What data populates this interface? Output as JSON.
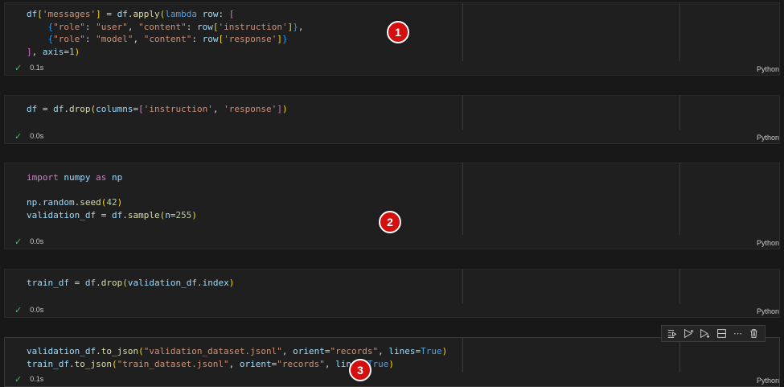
{
  "cells": [
    {
      "status_time": "0.1s",
      "language": "Python",
      "lines": [
        [
          [
            "v",
            "df"
          ],
          [
            "p",
            "["
          ],
          [
            "s",
            "'messages'"
          ],
          [
            "p",
            "]"
          ],
          [
            "t",
            " = "
          ],
          [
            "v",
            "df"
          ],
          [
            "t",
            "."
          ],
          [
            "f",
            "apply"
          ],
          [
            "p",
            "("
          ],
          [
            "kw",
            "lambda"
          ],
          [
            "t",
            " "
          ],
          [
            "v",
            "row"
          ],
          [
            "t",
            ": "
          ],
          [
            "p2",
            "["
          ]
        ],
        [
          [
            "t",
            "    "
          ],
          [
            "p3",
            "{"
          ],
          [
            "s",
            "\"role\""
          ],
          [
            "t",
            ": "
          ],
          [
            "s",
            "\"user\""
          ],
          [
            "t",
            ", "
          ],
          [
            "s",
            "\"content\""
          ],
          [
            "t",
            ": "
          ],
          [
            "v",
            "row"
          ],
          [
            "p",
            "["
          ],
          [
            "s",
            "'instruction'"
          ],
          [
            "p",
            "]"
          ],
          [
            "p3",
            "}"
          ],
          [
            "t",
            ","
          ]
        ],
        [
          [
            "t",
            "    "
          ],
          [
            "p3",
            "{"
          ],
          [
            "s",
            "\"role\""
          ],
          [
            "t",
            ": "
          ],
          [
            "s",
            "\"model\""
          ],
          [
            "t",
            ", "
          ],
          [
            "s",
            "\"content\""
          ],
          [
            "t",
            ": "
          ],
          [
            "v",
            "row"
          ],
          [
            "p",
            "["
          ],
          [
            "s",
            "'response'"
          ],
          [
            "p",
            "]"
          ],
          [
            "p3",
            "}"
          ]
        ],
        [
          [
            "p2",
            "]"
          ],
          [
            "t",
            ", "
          ],
          [
            "v",
            "axis"
          ],
          [
            "t",
            "="
          ],
          [
            "n",
            "1"
          ],
          [
            "p",
            ")"
          ]
        ]
      ]
    },
    {
      "status_time": "0.0s",
      "language": "Python",
      "lines": [
        [
          [
            "v",
            "df"
          ],
          [
            "t",
            " = "
          ],
          [
            "v",
            "df"
          ],
          [
            "t",
            "."
          ],
          [
            "f",
            "drop"
          ],
          [
            "p",
            "("
          ],
          [
            "v",
            "columns"
          ],
          [
            "t",
            "="
          ],
          [
            "p2",
            "["
          ],
          [
            "s",
            "'instruction'"
          ],
          [
            "t",
            ", "
          ],
          [
            "s",
            "'response'"
          ],
          [
            "p2",
            "]"
          ],
          [
            "p",
            ")"
          ]
        ]
      ]
    },
    {
      "status_time": "0.0s",
      "language": "Python",
      "lines": [
        [
          [
            "k",
            "import"
          ],
          [
            "t",
            " "
          ],
          [
            "v",
            "numpy"
          ],
          [
            "t",
            " "
          ],
          [
            "k",
            "as"
          ],
          [
            "t",
            " "
          ],
          [
            "v",
            "np"
          ]
        ],
        [
          [
            "t",
            ""
          ]
        ],
        [
          [
            "v",
            "np"
          ],
          [
            "t",
            "."
          ],
          [
            "v",
            "random"
          ],
          [
            "t",
            "."
          ],
          [
            "f",
            "seed"
          ],
          [
            "p",
            "("
          ],
          [
            "n",
            "42"
          ],
          [
            "p",
            ")"
          ]
        ],
        [
          [
            "v",
            "validation_df"
          ],
          [
            "t",
            " = "
          ],
          [
            "v",
            "df"
          ],
          [
            "t",
            "."
          ],
          [
            "f",
            "sample"
          ],
          [
            "p",
            "("
          ],
          [
            "v",
            "n"
          ],
          [
            "t",
            "="
          ],
          [
            "n",
            "255"
          ],
          [
            "p",
            ")"
          ]
        ]
      ]
    },
    {
      "status_time": "0.0s",
      "language": "Python",
      "lines": [
        [
          [
            "v",
            "train_df"
          ],
          [
            "t",
            " = "
          ],
          [
            "v",
            "df"
          ],
          [
            "t",
            "."
          ],
          [
            "f",
            "drop"
          ],
          [
            "p",
            "("
          ],
          [
            "v",
            "validation_df"
          ],
          [
            "t",
            "."
          ],
          [
            "v",
            "index"
          ],
          [
            "p",
            ")"
          ]
        ]
      ]
    },
    {
      "status_time": "0.1s",
      "language": "Python",
      "lines": [
        [
          [
            "v",
            "validation_df"
          ],
          [
            "t",
            "."
          ],
          [
            "f",
            "to_json"
          ],
          [
            "p",
            "("
          ],
          [
            "s",
            "\"validation_dataset.jsonl\""
          ],
          [
            "t",
            ", "
          ],
          [
            "v",
            "orient"
          ],
          [
            "t",
            "="
          ],
          [
            "s",
            "\"records\""
          ],
          [
            "t",
            ", "
          ],
          [
            "v",
            "lines"
          ],
          [
            "t",
            "="
          ],
          [
            "kw",
            "True"
          ],
          [
            "p",
            ")"
          ]
        ],
        [
          [
            "v",
            "train_df"
          ],
          [
            "t",
            "."
          ],
          [
            "f",
            "to_json"
          ],
          [
            "p",
            "("
          ],
          [
            "s",
            "\"train_dataset.jsonl\""
          ],
          [
            "t",
            ", "
          ],
          [
            "v",
            "orient"
          ],
          [
            "t",
            "="
          ],
          [
            "s",
            "\"records\""
          ],
          [
            "t",
            ", "
          ],
          [
            "v",
            "lines"
          ],
          [
            "t",
            "="
          ],
          [
            "kw",
            "True"
          ],
          [
            "p",
            ")"
          ]
        ]
      ]
    }
  ],
  "badges": [
    "1",
    "2",
    "3"
  ],
  "toolbar": {
    "buttons": [
      "run-by-line",
      "execute-above",
      "execute-below",
      "split-cell",
      "more",
      "delete"
    ]
  },
  "colors": {
    "check": "#4fb36a",
    "badge": "#d40f0f"
  }
}
